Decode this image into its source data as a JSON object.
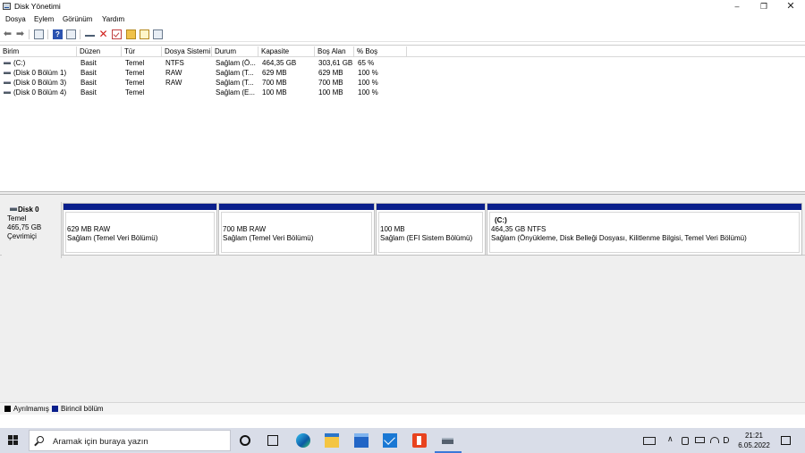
{
  "window": {
    "title": "Disk Yönetimi",
    "minimize": "–",
    "maximize": "❐",
    "close": "✕"
  },
  "menu": [
    "Dosya",
    "Eylem",
    "Görünüm",
    "Yardım"
  ],
  "toolbar": {
    "icons": [
      "back-arrow-icon",
      "forward-arrow-icon",
      "console-tree-icon",
      "help-icon",
      "properties-icon",
      "link-icon",
      "delete-icon",
      "check-icon",
      "new-folder-icon",
      "open-folder-icon",
      "view-icon"
    ],
    "back": "⬅",
    "forward": "➡",
    "help": "?",
    "delete": "✕"
  },
  "list": {
    "columns": [
      "Birim",
      "Düzen",
      "Tür",
      "Dosya Sistemi",
      "Durum",
      "Kapasite",
      "Boş Alan",
      "% Boş"
    ],
    "rows": [
      [
        "(C:)",
        "Basit",
        "Temel",
        "NTFS",
        "Sağlam (Ö...",
        "464,35 GB",
        "303,61 GB",
        "65 %"
      ],
      [
        "(Disk 0 Bölüm 1)",
        "Basit",
        "Temel",
        "RAW",
        "Sağlam (T...",
        "629 MB",
        "629 MB",
        "100 %"
      ],
      [
        "(Disk 0 Bölüm 3)",
        "Basit",
        "Temel",
        "RAW",
        "Sağlam (T...",
        "700 MB",
        "700 MB",
        "100 %"
      ],
      [
        "(Disk 0 Bölüm 4)",
        "Basit",
        "Temel",
        "",
        "Sağlam (E...",
        "100 MB",
        "100 MB",
        "100 %"
      ]
    ]
  },
  "disk": {
    "name": "Disk 0",
    "type": "Temel",
    "size": "465,75 GB",
    "status": "Çevrimiçi",
    "partitions": [
      {
        "title": "",
        "line1": "629 MB RAW",
        "line2": "Sağlam (Temel Veri Bölümü)"
      },
      {
        "title": "",
        "line1": "700 MB RAW",
        "line2": "Sağlam (Temel Veri Bölümü)"
      },
      {
        "title": "",
        "line1": "100 MB",
        "line2": "Sağlam (EFI Sistem Bölümü)"
      },
      {
        "title": "(C:)",
        "line1": "464,35 GB NTFS",
        "line2": "Sağlam (Önyükleme, Disk Belleği Dosyası, Kilitlenme Bilgisi, Temel Veri Bölümü)"
      }
    ]
  },
  "legend": [
    {
      "label": "Ayrılmamış",
      "color": "#000000"
    },
    {
      "label": "Birincil bölüm",
      "color": "#0a1f8c"
    }
  ],
  "taskbar": {
    "search_placeholder": "Aramak için buraya yazın",
    "time": "21:21",
    "date": "6.05.2022",
    "tray_chevron": "∧"
  }
}
